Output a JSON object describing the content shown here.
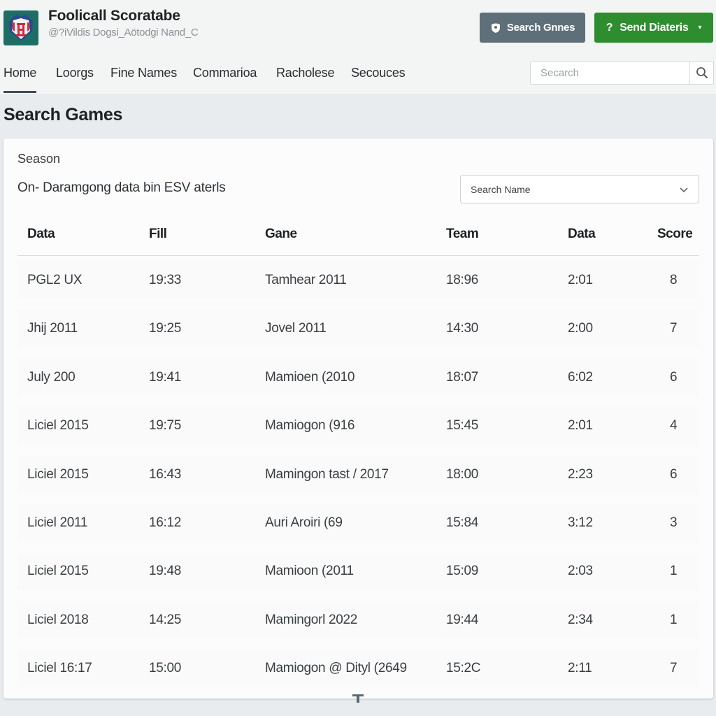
{
  "app": {
    "title": "Foolicall Scoratabe",
    "subtitle": "@?iVildis Dogsi_Aötodgi Nand_C",
    "logo_icon": "shield-crest-icon"
  },
  "header": {
    "search_games_button": {
      "label": "Search Gnnes",
      "icon": "shield-icon"
    },
    "send_button": {
      "label": "Send Diateris",
      "icon": "question-icon",
      "caret": "▾"
    }
  },
  "nav": {
    "items": [
      {
        "label": "Home",
        "active": true
      },
      {
        "label": "Loorgs",
        "active": false
      },
      {
        "label": "Fine Names",
        "active": false
      },
      {
        "label": "Commarioa",
        "active": false
      },
      {
        "label": "Racholese",
        "active": false
      },
      {
        "label": "Secouces",
        "active": false
      }
    ],
    "search": {
      "placeholder": "Secarch",
      "value": "",
      "icon": "search-icon"
    }
  },
  "page": {
    "title": "Search Games"
  },
  "filters": {
    "season_label": "Season",
    "description": "On- Daramgong data bin ESV aterls",
    "select": {
      "value": "Search Name",
      "icon": "chevron-down-icon"
    }
  },
  "table": {
    "columns": [
      "Data",
      "Fill",
      "Gane",
      "Team",
      "Data",
      "Score"
    ],
    "rows": [
      [
        "PGL2 UX",
        "19:33",
        "Tamhear 2011",
        "18:96",
        "2:01",
        "8"
      ],
      [
        "Jhij 2011",
        "19:25",
        "Jovel 2011",
        "14:30",
        "2:00",
        "7"
      ],
      [
        "July 200",
        "19:41",
        "Mamioen (2010",
        "18:07",
        "6:02",
        "6"
      ],
      [
        "Liciel 2015",
        "19:75",
        "Mamiogon (916",
        "15:45",
        "2:01",
        "4"
      ],
      [
        "Liciel 2015",
        "16:43",
        "Mamingon tast / 2017",
        "18:00",
        "2:23",
        "6"
      ],
      [
        "Liciel 2011",
        "16:12",
        "Auri Aroiri (69",
        "15:84",
        "3:12",
        "3"
      ],
      [
        "Liciel 2015",
        "19:48",
        "Mamioon (2011",
        "15:09",
        "2:03",
        "1"
      ],
      [
        "Liciel 2018",
        "14:25",
        "Mamingorl 2022",
        "19:44",
        "2:34",
        "1"
      ],
      [
        "Liciel 16:17",
        "15:00",
        "Mamiogon @ Dityl (2649",
        "15:2C",
        "2:11",
        "7"
      ]
    ]
  },
  "colors": {
    "primary_button": "#5e6f79",
    "accent_green": "#2d8d2f",
    "logo_bg": "#1e6e66",
    "nav_active_underline": "#3e4e59"
  }
}
